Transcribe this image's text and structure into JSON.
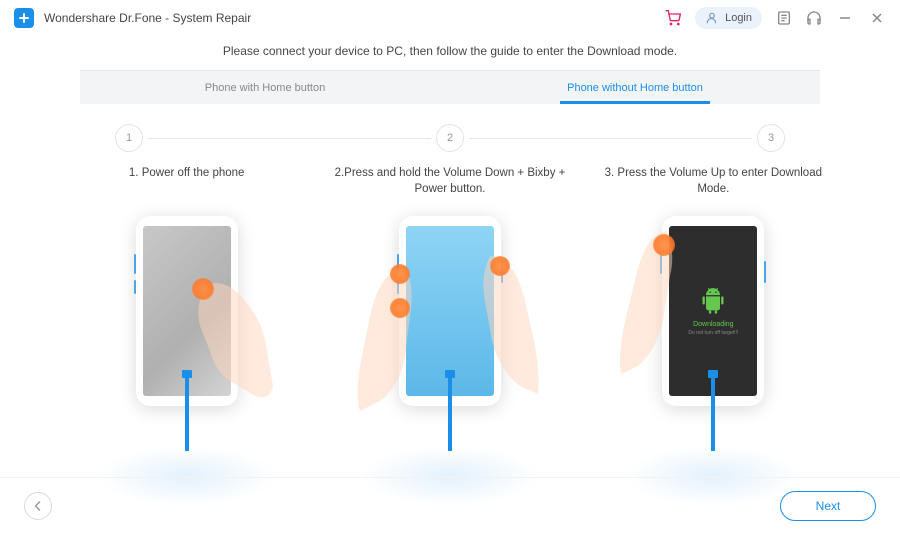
{
  "header": {
    "app_title": "Wondershare Dr.Fone - System Repair",
    "login_label": "Login"
  },
  "instruction": "Please connect your device to PC, then follow the guide to enter the Download mode.",
  "tabs": [
    {
      "label": "Phone with Home button",
      "active": false
    },
    {
      "label": "Phone without Home button",
      "active": true
    }
  ],
  "stepper": {
    "step1": "1",
    "step2": "2",
    "step3": "3"
  },
  "steps": [
    {
      "text": "1. Power off the phone"
    },
    {
      "text": "2.Press and hold the Volume Down + Bixby + Power button."
    },
    {
      "text": "3. Press the Volume Up to enter Download Mode."
    }
  ],
  "download_screen": {
    "title": "Downloading",
    "subtitle": "Do not turn off target!!!"
  },
  "footer": {
    "next_label": "Next"
  }
}
